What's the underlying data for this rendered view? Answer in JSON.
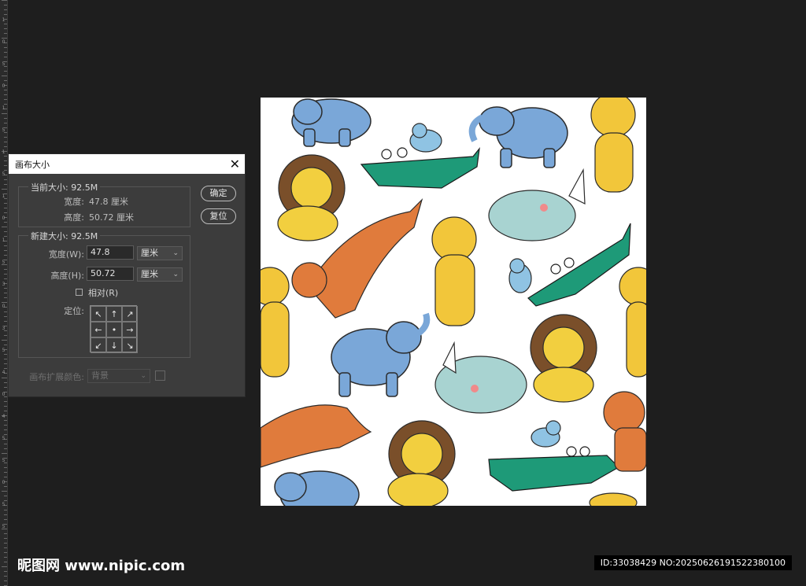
{
  "ruler": {
    "labels": [
      "1",
      "0",
      "5",
      "0",
      "1",
      "5",
      "1",
      "5",
      "1",
      "0",
      "1",
      "5",
      "3",
      "0",
      "3",
      "5",
      "4",
      "0",
      "4",
      "5",
      "5",
      "0",
      "5",
      "5"
    ]
  },
  "dialog": {
    "title": "画布大小",
    "close_icon": "close-icon",
    "current_size_legend": "当前大小: 92.5M",
    "current_width_label": "宽度:",
    "current_width_value": "47.8 厘米",
    "current_height_label": "高度:",
    "current_height_value": "50.72 厘米",
    "new_size_legend": "新建大小: 92.5M",
    "width_label": "宽度(W):",
    "width_value": "47.8",
    "width_unit": "厘米",
    "height_label": "高度(H):",
    "height_value": "50.72",
    "height_unit": "厘米",
    "relative_label": "相对(R)",
    "anchor_label": "定位:",
    "anchor_cells": [
      "↖",
      "↑",
      "↗",
      "←",
      "•",
      "→",
      "↙",
      "↓",
      "↘"
    ],
    "extension_color_label": "画布扩展颜色:",
    "extension_color_value": "背景",
    "ok_button": "确定",
    "reset_button": "复位"
  },
  "watermark": {
    "site_name": "昵图网 www.nipic.com",
    "id_text": "ID:33038429 NO:20250626191522380100"
  },
  "colors": {
    "background": "#1e1e1e",
    "dialog": "#3c3c3c",
    "canvas": "#ffffff",
    "elephant": "#7aa7d8",
    "crocodile": "#1e9a78",
    "lion_mane": "#7a4f2a",
    "lion_face": "#f2cf3f",
    "tiger": "#f2c63a",
    "leopard": "#e07b3c",
    "rhino": "#a8d3d1",
    "bird": "#8fc3e3"
  }
}
